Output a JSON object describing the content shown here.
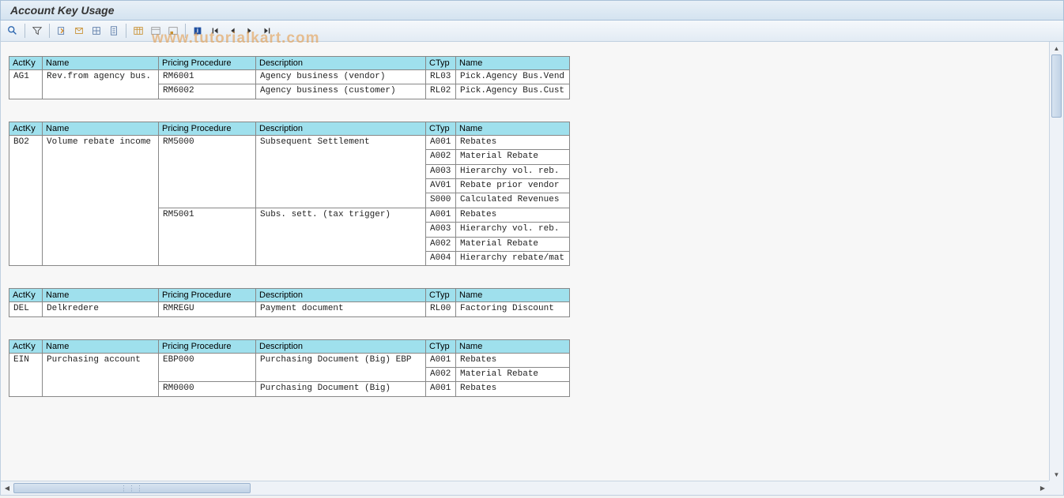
{
  "title": "Account Key Usage",
  "watermark": "www.tutorialkart.com",
  "headers": {
    "actky": "ActKy",
    "name1": "Name",
    "proc": "Pricing Procedure",
    "desc": "Description",
    "ctyp": "CTyp",
    "name2": "Name"
  },
  "groups": [
    {
      "actky": "AG1",
      "name": "Rev.from agency bus.",
      "rows": [
        {
          "proc": "RM6001",
          "desc": "Agency business (vendor)",
          "ctyp": "RL03",
          "name2": "Pick.Agency Bus.Vend"
        },
        {
          "proc": "RM6002",
          "desc": "Agency business (customer)",
          "ctyp": "RL02",
          "name2": "Pick.Agency Bus.Cust"
        }
      ]
    },
    {
      "actky": "BO2",
      "name": "Volume rebate income",
      "rows": [
        {
          "proc": "RM5000",
          "desc": "Subsequent Settlement",
          "ctyp": "A001",
          "name2": "Rebates"
        },
        {
          "proc": "",
          "desc": "",
          "ctyp": "A002",
          "name2": "Material Rebate"
        },
        {
          "proc": "",
          "desc": "",
          "ctyp": "A003",
          "name2": "Hierarchy vol. reb."
        },
        {
          "proc": "",
          "desc": "",
          "ctyp": "AV01",
          "name2": "Rebate prior vendor"
        },
        {
          "proc": "",
          "desc": "",
          "ctyp": "S000",
          "name2": "Calculated Revenues"
        },
        {
          "proc": "RM5001",
          "desc": "Subs. sett. (tax trigger)",
          "ctyp": "A001",
          "name2": "Rebates"
        },
        {
          "proc": "",
          "desc": "",
          "ctyp": "A003",
          "name2": "Hierarchy vol. reb."
        },
        {
          "proc": "",
          "desc": "",
          "ctyp": "A002",
          "name2": "Material Rebate"
        },
        {
          "proc": "",
          "desc": "",
          "ctyp": "A004",
          "name2": "Hierarchy rebate/mat"
        }
      ]
    },
    {
      "actky": "DEL",
      "name": "Delkredere",
      "rows": [
        {
          "proc": "RMREGU",
          "desc": "Payment document",
          "ctyp": "RL00",
          "name2": "Factoring Discount"
        }
      ]
    },
    {
      "actky": "EIN",
      "name": "Purchasing account",
      "rows": [
        {
          "proc": "EBP000",
          "desc": "Purchasing Document (Big) EBP",
          "ctyp": "A001",
          "name2": "Rebates"
        },
        {
          "proc": "",
          "desc": "",
          "ctyp": "A002",
          "name2": "Material Rebate"
        },
        {
          "proc": "RM0000",
          "desc": "Purchasing Document (Big)",
          "ctyp": "A001",
          "name2": "Rebates"
        }
      ]
    }
  ]
}
